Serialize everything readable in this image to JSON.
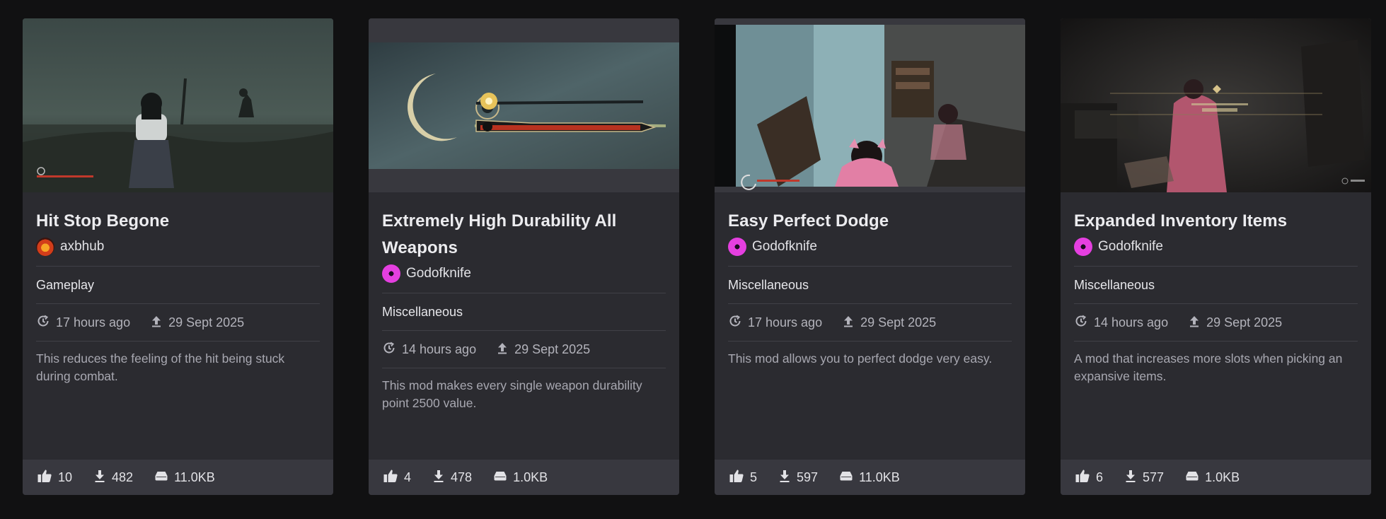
{
  "cards": [
    {
      "title": "Hit Stop Begone",
      "author": "axbhub",
      "category": "Gameplay",
      "updated": "17 hours ago",
      "uploaded": "29 Sept 2025",
      "description": "This reduces the feeling of the hit being stuck during combat.",
      "endorsements": "10",
      "downloads": "482",
      "size": "11.0KB"
    },
    {
      "title": "Extremely High Durability All Weapons",
      "author": "Godofknife",
      "category": "Miscellaneous",
      "updated": "14 hours ago",
      "uploaded": "29 Sept 2025",
      "description": "This mod makes every single weapon durability point 2500 value.",
      "endorsements": "4",
      "downloads": "478",
      "size": "1.0KB"
    },
    {
      "title": "Easy Perfect Dodge",
      "author": "Godofknife",
      "category": "Miscellaneous",
      "updated": "17 hours ago",
      "uploaded": "29 Sept 2025",
      "description": "This mod allows you to perfect dodge very easy.",
      "endorsements": "5",
      "downloads": "597",
      "size": "11.0KB"
    },
    {
      "title": "Expanded Inventory Items",
      "author": "Godofknife",
      "category": "Miscellaneous",
      "updated": "14 hours ago",
      "uploaded": "29 Sept 2025",
      "description": "A mod that increases more slots when picking an expansive items.",
      "endorsements": "6",
      "downloads": "577",
      "size": "1.0KB"
    }
  ],
  "icons": {
    "updated": "clock-refresh-icon",
    "uploaded": "upload-icon",
    "endorsements": "thumbs-up-icon",
    "downloads": "download-icon",
    "size": "hard-drive-icon"
  },
  "colors": {
    "page_bg": "#111112",
    "card_bg": "#2b2b30",
    "footer_bg": "#38383f"
  }
}
